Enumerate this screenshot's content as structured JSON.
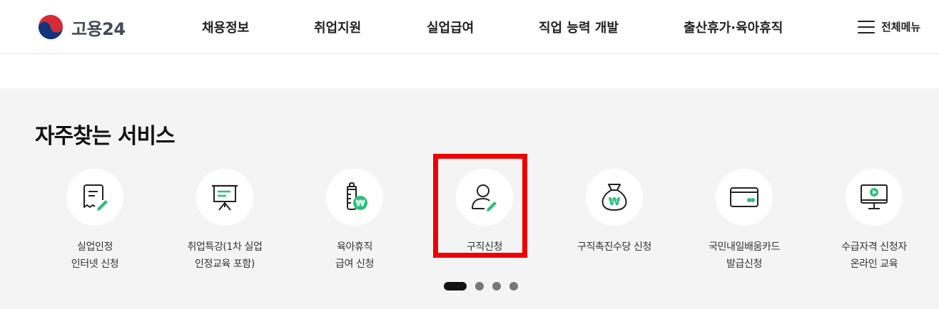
{
  "brand": {
    "logo_text": "고용24"
  },
  "nav": {
    "items": [
      "채용정보",
      "취업지원",
      "실업급여",
      "직업 능력 개발",
      "출산휴가·육아휴직"
    ],
    "all_menu_label": "전체메뉴"
  },
  "services": {
    "title": "자주찾는 서비스",
    "items": [
      {
        "label_line1": "실업인정",
        "label_line2": "인터넷 신청",
        "icon": "document-pen-icon"
      },
      {
        "label_line1": "취업특강(1차 실업",
        "label_line2": "인정교육 포함)",
        "icon": "presentation-board-icon"
      },
      {
        "label_line1": "육아휴직",
        "label_line2": "급여 신청",
        "icon": "baby-bottle-won-icon"
      },
      {
        "label_line1": "구직신청",
        "label_line2": "",
        "icon": "person-pen-icon"
      },
      {
        "label_line1": "구직촉진수당 신청",
        "label_line2": "",
        "icon": "money-bag-won-icon"
      },
      {
        "label_line1": "국민내일배움카드",
        "label_line2": "발급신청",
        "icon": "card-icon"
      },
      {
        "label_line1": "수급자격 신청자",
        "label_line2": "온라인 교육",
        "icon": "monitor-play-icon"
      }
    ],
    "highlighted_item": "구직신청",
    "pager": {
      "total_pages": 4,
      "current_page": 1
    }
  },
  "colors": {
    "accent_green": "#2bbf7a",
    "highlight_red": "#ee0000",
    "section_bg": "#f4f4f4"
  }
}
